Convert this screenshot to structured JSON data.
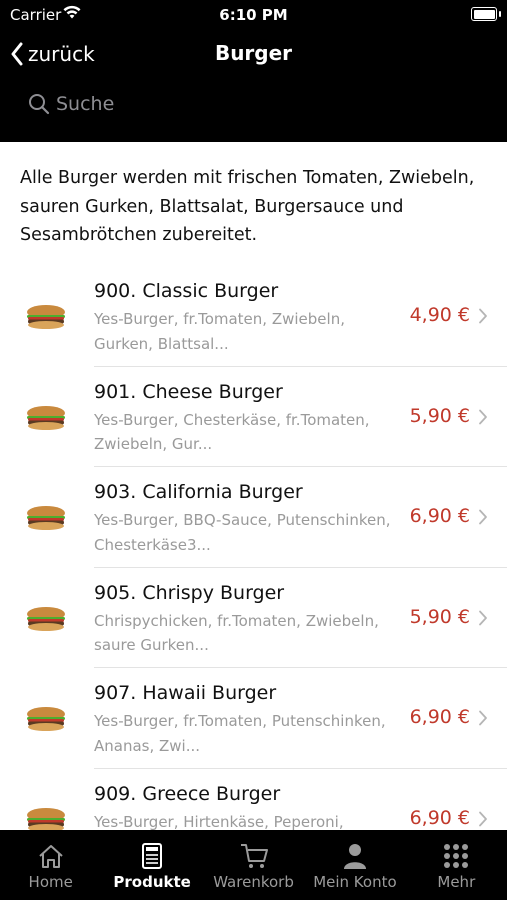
{
  "status": {
    "carrier": "Carrier",
    "time": "6:10 PM"
  },
  "nav": {
    "back_label": "zurück",
    "title": "Burger"
  },
  "search": {
    "placeholder": "Suche"
  },
  "intro": "Alle Burger werden mit frischen Tomaten, Zwiebeln, sauren Gurken, Blattsalat, Burgersauce und Sesambrötchen zubereitet.",
  "colors": {
    "price": "#c0392b",
    "header_bg": "#000000",
    "tabbar_bg": "#000000"
  },
  "products": [
    {
      "name": "900. Classic Burger",
      "desc": "Yes-Burger, fr.Tomaten, Zwiebeln, Gurken, Blattsal...",
      "price": "4,90 €"
    },
    {
      "name": "901. Cheese Burger",
      "desc": "Yes-Burger, Chesterkäse, fr.Tomaten, Zwiebeln, Gur...",
      "price": "5,90 €"
    },
    {
      "name": "903. California Burger",
      "desc": "Yes-Burger, BBQ-Sauce, Putenschinken, Chesterkäse3...",
      "price": "6,90 €"
    },
    {
      "name": "905. Chrispy Burger",
      "desc": "Chrispychicken, fr.Tomaten, Zwiebeln, saure Gurken...",
      "price": "5,90 €"
    },
    {
      "name": "907. Hawaii Burger",
      "desc": "Yes-Burger, fr.Tomaten, Putenschinken, Ananas, Zwi...",
      "price": "6,90 €"
    },
    {
      "name": "909. Greece Burger",
      "desc": "Yes-Burger, Hirtenkäse, Peperoni,",
      "price": "6,90 €"
    }
  ],
  "tabs": [
    {
      "label": "Home",
      "icon": "home-icon",
      "active": false
    },
    {
      "label": "Produkte",
      "icon": "menu-card-icon",
      "active": true
    },
    {
      "label": "Warenkorb",
      "icon": "cart-icon",
      "active": false
    },
    {
      "label": "Mein Konto",
      "icon": "person-icon",
      "active": false
    },
    {
      "label": "Mehr",
      "icon": "grid-icon",
      "active": false
    }
  ]
}
